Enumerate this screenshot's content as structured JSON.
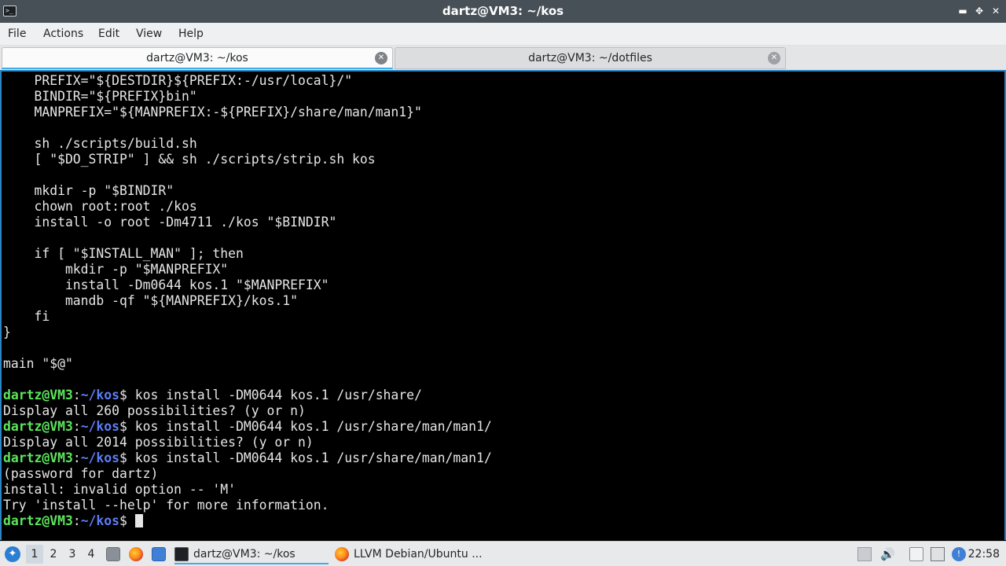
{
  "window": {
    "title": "dartz@VM3: ~/kos",
    "minimize_glyph": "▬",
    "maximize_glyph": "✥",
    "close_glyph": "✕",
    "app_icon_glyph": ">_"
  },
  "menu": {
    "file": "File",
    "actions": "Actions",
    "edit": "Edit",
    "view": "View",
    "help": "Help"
  },
  "tabs": [
    {
      "label": "dartz@VM3: ~/kos",
      "active": true
    },
    {
      "label": "dartz@VM3: ~/dotfiles",
      "active": false
    }
  ],
  "terminal": {
    "lines": [
      "    PREFIX=\"${DESTDIR}${PREFIX:-/usr/local}/\"",
      "    BINDIR=\"${PREFIX}bin\"",
      "    MANPREFIX=\"${MANPREFIX:-${PREFIX}/share/man/man1}\"",
      "",
      "    sh ./scripts/build.sh",
      "    [ \"$DO_STRIP\" ] && sh ./scripts/strip.sh kos",
      "",
      "    mkdir -p \"$BINDIR\"",
      "    chown root:root ./kos",
      "    install -o root -Dm4711 ./kos \"$BINDIR\"",
      "",
      "    if [ \"$INSTALL_MAN\" ]; then",
      "        mkdir -p \"$MANPREFIX\"",
      "        install -Dm0644 kos.1 \"$MANPREFIX\"",
      "        mandb -qf \"${MANPREFIX}/kos.1\"",
      "    fi",
      "}",
      "",
      "main \"$@\"",
      ""
    ],
    "prompt_user": "dartz@VM3",
    "prompt_sep": ":",
    "prompt_path": "~/kos",
    "prompt_end": "$ ",
    "session": [
      {
        "type": "cmd",
        "text": "kos install -DM0644 kos.1 /usr/share/"
      },
      {
        "type": "out",
        "text": "Display all 260 possibilities? (y or n)"
      },
      {
        "type": "cmd",
        "text": "kos install -DM0644 kos.1 /usr/share/man/man1/"
      },
      {
        "type": "out",
        "text": "Display all 2014 possibilities? (y or n)"
      },
      {
        "type": "cmd",
        "text": "kos install -DM0644 kos.1 /usr/share/man/man1/"
      },
      {
        "type": "out",
        "text": "(password for dartz)"
      },
      {
        "type": "out",
        "text": "install: invalid option -- 'M'"
      },
      {
        "type": "out",
        "text": "Try 'install --help' for more information."
      },
      {
        "type": "prompt",
        "text": ""
      }
    ]
  },
  "taskbar": {
    "desktops": [
      "1",
      "2",
      "3",
      "4"
    ],
    "active_desktop": "1",
    "tasks": [
      {
        "label": "dartz@VM3: ~/kos",
        "icon": "terminal-icon",
        "active": true
      },
      {
        "label": "LLVM Debian/Ubuntu ...",
        "icon": "firefox-icon",
        "active": false
      }
    ],
    "clock": "22:58"
  }
}
